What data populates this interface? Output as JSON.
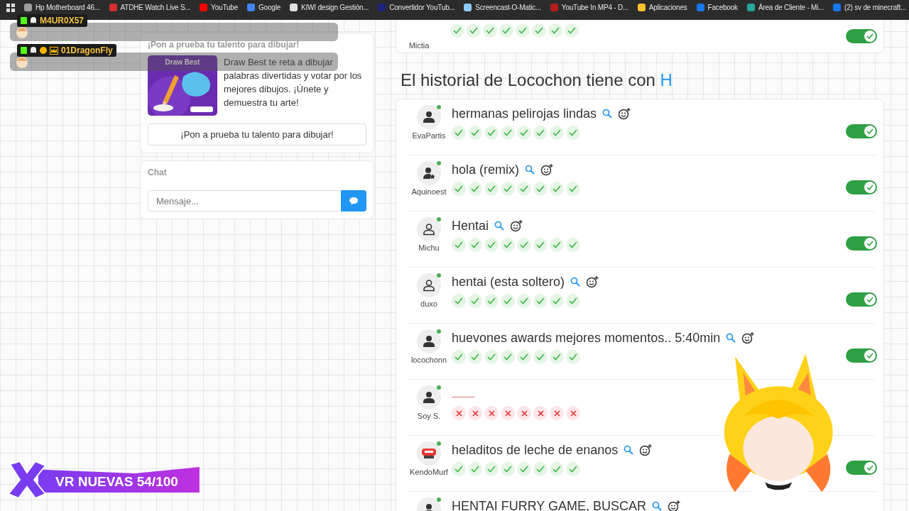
{
  "bookmarks": [
    {
      "label": "Hp Motherboard 46...",
      "color": "#9e9e9e"
    },
    {
      "label": "ATDHE Watch Live S...",
      "color": "#d32f2f"
    },
    {
      "label": "YouTube",
      "color": "#ff0000"
    },
    {
      "label": "Google",
      "color": "#4285f4"
    },
    {
      "label": "KIWI design Gestión...",
      "color": "#e0e0e0"
    },
    {
      "label": "Convertidor YouTub...",
      "color": "#1a237e"
    },
    {
      "label": "Screencast-O-Matic...",
      "color": "#90caf9"
    },
    {
      "label": "YouTube In MP4 - D...",
      "color": "#b71c1c"
    },
    {
      "label": "Aplicaciones",
      "color": "#fbc02d"
    },
    {
      "label": "Facebook",
      "color": "#1877f2"
    },
    {
      "label": "Área de Cliente - Mi...",
      "color": "#26a69a"
    },
    {
      "label": "(2) sv de minecraft...",
      "color": "#1877f2"
    }
  ],
  "promo": {
    "title": "¡Pon a prueba tu talento para dibujar!",
    "image": {
      "kind": "picture",
      "caption": "Draw Best"
    },
    "text": "Draw Best te reta a dibujar palabras divertidas y votar por los mejores dibujos. ¡Únete y demuestra tu arte!",
    "button": "¡Pon a prueba tu talento para dibujar!"
  },
  "chat": {
    "title": "Chat",
    "placeholder": "Mensaje..."
  },
  "previous_row": {
    "user": "Mictia",
    "marks": [
      {
        "kind": "ok"
      },
      {
        "kind": "ok"
      },
      {
        "kind": "ok"
      },
      {
        "kind": "ok"
      },
      {
        "kind": "ok"
      },
      {
        "kind": "ok"
      },
      {
        "kind": "ok"
      },
      {
        "kind": "ok"
      }
    ],
    "toggle_on": true
  },
  "history": {
    "title": "El historial de Locochon tiene con",
    "letter": "H"
  },
  "rows": [
    {
      "user": "EvaPartis",
      "avatar": {
        "kind": "person"
      },
      "online": true,
      "answer": "hermanas pelirojas lindas",
      "marks": [
        {
          "kind": "ok"
        },
        {
          "kind": "ok"
        },
        {
          "kind": "ok"
        },
        {
          "kind": "ok"
        },
        {
          "kind": "ok"
        },
        {
          "kind": "ok"
        },
        {
          "kind": "ok"
        },
        {
          "kind": "ok"
        }
      ],
      "toggle_on": true
    },
    {
      "user": "Aquinoest",
      "avatar": {
        "kind": "person-star"
      },
      "online": true,
      "answer": "hola (remix)",
      "marks": [
        {
          "kind": "ok"
        },
        {
          "kind": "ok"
        },
        {
          "kind": "ok"
        },
        {
          "kind": "ok"
        },
        {
          "kind": "ok"
        },
        {
          "kind": "ok"
        },
        {
          "kind": "ok"
        },
        {
          "kind": "ok"
        }
      ],
      "toggle_on": true
    },
    {
      "user": "Michu",
      "avatar": {
        "kind": "person-outline"
      },
      "online": true,
      "answer": "Hentai",
      "marks": [
        {
          "kind": "ok"
        },
        {
          "kind": "ok"
        },
        {
          "kind": "ok"
        },
        {
          "kind": "ok"
        },
        {
          "kind": "ok"
        },
        {
          "kind": "ok"
        },
        {
          "kind": "ok"
        },
        {
          "kind": "ok"
        }
      ],
      "toggle_on": true
    },
    {
      "user": "duxo",
      "avatar": {
        "kind": "person-outline"
      },
      "online": true,
      "answer": "hentai (esta soltero)",
      "marks": [
        {
          "kind": "ok"
        },
        {
          "kind": "ok"
        },
        {
          "kind": "ok"
        },
        {
          "kind": "ok"
        },
        {
          "kind": "ok"
        },
        {
          "kind": "ok"
        },
        {
          "kind": "ok"
        },
        {
          "kind": "ok"
        }
      ],
      "toggle_on": true
    },
    {
      "user": "locochonn",
      "avatar": {
        "kind": "person"
      },
      "online": true,
      "answer": "huevones awards mejores momentos.. 5:40min",
      "marks": [
        {
          "kind": "ok"
        },
        {
          "kind": "ok"
        },
        {
          "kind": "ok"
        },
        {
          "kind": "ok"
        },
        {
          "kind": "ok"
        },
        {
          "kind": "ok"
        },
        {
          "kind": "ok"
        },
        {
          "kind": "ok"
        }
      ],
      "toggle_on": true
    },
    {
      "user": "Soy S.",
      "avatar": {
        "kind": "person"
      },
      "online": true,
      "marks": [
        {
          "kind": "bad"
        },
        {
          "kind": "bad"
        },
        {
          "kind": "bad"
        },
        {
          "kind": "bad"
        },
        {
          "kind": "bad"
        },
        {
          "kind": "bad"
        },
        {
          "kind": "bad"
        },
        {
          "kind": "bad"
        }
      ]
    },
    {
      "user": "KendoMurf",
      "avatar": {
        "kind": "stop"
      },
      "online": true,
      "answer": "heladitos de leche de enanos",
      "marks": [
        {
          "kind": "ok"
        },
        {
          "kind": "ok"
        },
        {
          "kind": "ok"
        },
        {
          "kind": "ok"
        },
        {
          "kind": "ok"
        },
        {
          "kind": "ok"
        },
        {
          "kind": "ok"
        },
        {
          "kind": "ok"
        }
      ],
      "toggle_on": true
    },
    {
      "avatar": {
        "kind": "person"
      },
      "online": true,
      "answer": "HENTAI FURRY GAME, BUSCAR"
    }
  ],
  "stream_chat": [
    {
      "name": "M4UR0X57",
      "badges": [
        {
          "kind": "k"
        },
        {
          "kind": "ghost"
        }
      ]
    },
    {
      "name": "01DragonFly",
      "badges": [
        {
          "kind": "k"
        },
        {
          "kind": "ghost"
        },
        {
          "kind": "one"
        },
        {
          "kind": "crown"
        }
      ]
    }
  ],
  "banner": {
    "text": "VR NUEVAS 54/100"
  }
}
